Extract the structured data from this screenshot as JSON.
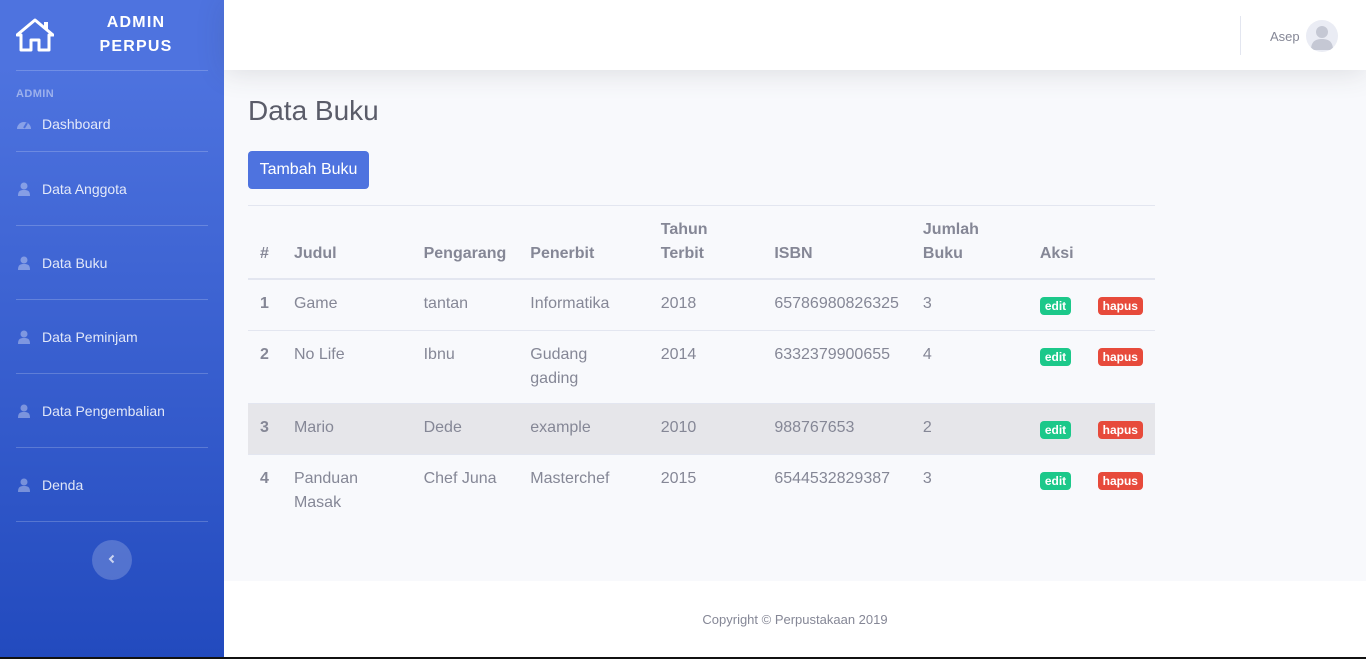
{
  "brand": {
    "line1": "ADMIN",
    "line2": "PERPUS",
    "icon": "home-icon"
  },
  "sidebar": {
    "heading": "ADMIN",
    "items": [
      {
        "label": "Dashboard",
        "icon": "tachometer-icon"
      },
      {
        "label": "Data Anggota",
        "icon": "user-icon"
      },
      {
        "label": "Data Buku",
        "icon": "user-icon"
      },
      {
        "label": "Data Peminjam",
        "icon": "user-icon"
      },
      {
        "label": "Data Pengembalian",
        "icon": "user-icon"
      },
      {
        "label": "Denda",
        "icon": "user-icon"
      }
    ],
    "toggle_icon": "chevron-left-icon"
  },
  "topbar": {
    "user_name": "Asep",
    "avatar_icon": "user-avatar-icon"
  },
  "main": {
    "title": "Data Buku",
    "add_button": "Tambah Buku",
    "table": {
      "headers": [
        "#",
        "Judul",
        "Pengarang",
        "Penerbit",
        "Tahun Terbit",
        "ISBN",
        "Jumlah Buku",
        "Aksi"
      ],
      "rows": [
        {
          "no": "1",
          "judul": "Game",
          "pengarang": "tantan",
          "penerbit": "Informatika",
          "tahun": "2018",
          "isbn": "65786980826325",
          "jumlah": "3",
          "edit": "edit",
          "hapus": "hapus"
        },
        {
          "no": "2",
          "judul": "No Life",
          "pengarang": "Ibnu",
          "penerbit": "Gudang gading",
          "tahun": "2014",
          "isbn": "6332379900655",
          "jumlah": "4",
          "edit": "edit",
          "hapus": "hapus"
        },
        {
          "no": "3",
          "judul": "Mario",
          "pengarang": "Dede",
          "penerbit": "example",
          "tahun": "2010",
          "isbn": "988767653",
          "jumlah": "2",
          "edit": "edit",
          "hapus": "hapus"
        },
        {
          "no": "4",
          "judul": "Panduan Masak",
          "pengarang": "Chef Juna",
          "penerbit": "Masterchef",
          "tahun": "2015",
          "isbn": "6544532829387",
          "jumlah": "3",
          "edit": "edit",
          "hapus": "hapus"
        }
      ]
    }
  },
  "footer": {
    "copyright": "Copyright © Perpustakaan 2019"
  },
  "colors": {
    "primary": "#4e73df",
    "success": "#1cc88a",
    "danger": "#e74a3b",
    "text": "#858796"
  }
}
